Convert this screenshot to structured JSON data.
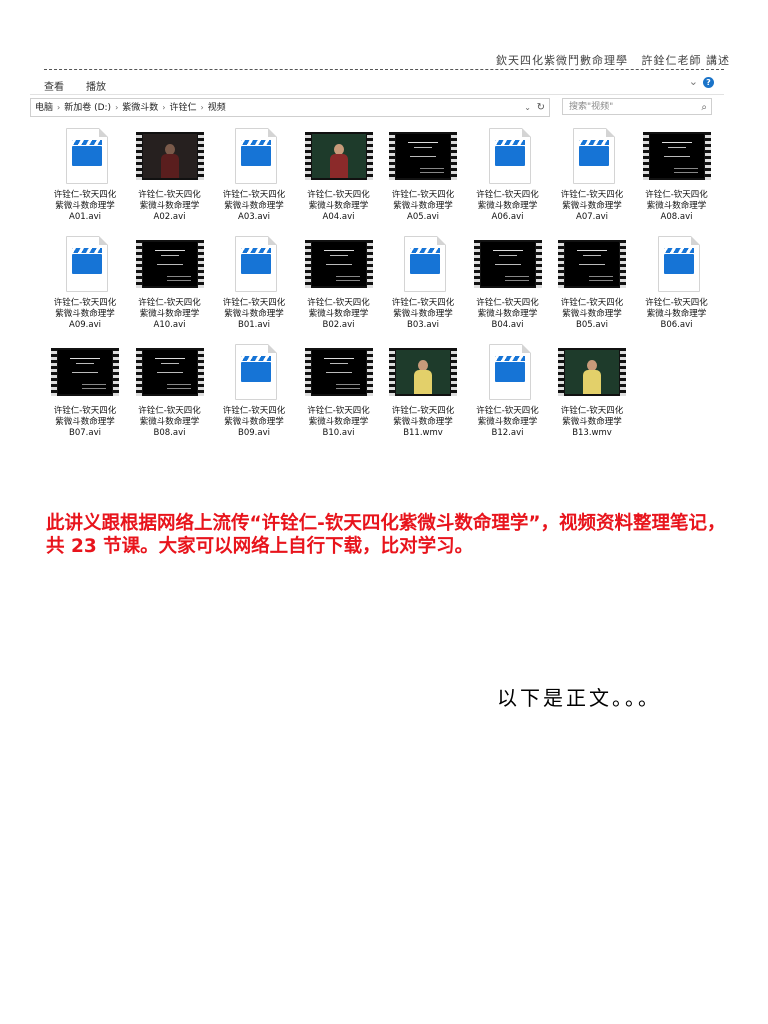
{
  "header": {
    "title": "欽天四化紫微鬥數命理學",
    "author": "許銓仁老師 講述"
  },
  "explorer": {
    "ribbon": {
      "tab_view": "查看",
      "tab_play": "播放"
    },
    "breadcrumb": [
      "电脑",
      "新加卷 (D:)",
      "紫微斗数",
      "许铨仁",
      "视频"
    ],
    "search_placeholder": "搜索\"视频\"",
    "icons": {
      "play": "video-file-icon",
      "thumbnail": "video-thumbnail"
    },
    "files": [
      {
        "line1": "许铨仁-钦天四化",
        "line2": "紫微斗数命理学",
        "line3": "A01.avi",
        "thumb": "icon"
      },
      {
        "line1": "许铨仁-钦天四化",
        "line2": "紫微斗数命理学",
        "line3": "A02.avi",
        "thumb": "dark-man"
      },
      {
        "line1": "许铨仁-钦天四化",
        "line2": "紫微斗数命理学",
        "line3": "A03.avi",
        "thumb": "icon"
      },
      {
        "line1": "许铨仁-钦天四化",
        "line2": "紫微斗数命理学",
        "line3": "A04.avi",
        "thumb": "blackboard"
      },
      {
        "line1": "许铨仁-钦天四化",
        "line2": "紫微斗数命理学",
        "line3": "A05.avi",
        "thumb": "slide"
      },
      {
        "line1": "许铨仁-钦天四化",
        "line2": "紫微斗数命理学",
        "line3": "A06.avi",
        "thumb": "icon"
      },
      {
        "line1": "许铨仁-钦天四化",
        "line2": "紫微斗数命理学",
        "line3": "A07.avi",
        "thumb": "icon"
      },
      {
        "line1": "许铨仁-钦天四化",
        "line2": "紫微斗数命理学",
        "line3": "A08.avi",
        "thumb": "slide"
      },
      {
        "line1": "许铨仁-钦天四化",
        "line2": "紫微斗数命理学",
        "line3": "A09.avi",
        "thumb": "icon"
      },
      {
        "line1": "许铨仁-钦天四化",
        "line2": "紫微斗数命理学",
        "line3": "A10.avi",
        "thumb": "slide"
      },
      {
        "line1": "许铨仁-钦天四化",
        "line2": "紫微斗数命理学",
        "line3": "B01.avi",
        "thumb": "icon"
      },
      {
        "line1": "许铨仁-钦天四化",
        "line2": "紫微斗数命理学",
        "line3": "B02.avi",
        "thumb": "slide"
      },
      {
        "line1": "许铨仁-钦天四化",
        "line2": "紫微斗数命理学",
        "line3": "B03.avi",
        "thumb": "icon"
      },
      {
        "line1": "许铨仁-钦天四化",
        "line2": "紫微斗数命理学",
        "line3": "B04.avi",
        "thumb": "slide"
      },
      {
        "line1": "许铨仁-钦天四化",
        "line2": "紫微斗数命理学",
        "line3": "B05.avi",
        "thumb": "slide"
      },
      {
        "line1": "许铨仁-钦天四化",
        "line2": "紫微斗数命理学",
        "line3": "B06.avi",
        "thumb": "icon"
      },
      {
        "line1": "许铨仁-钦天四化",
        "line2": "紫微斗数命理学",
        "line3": "B07.avi",
        "thumb": "slide"
      },
      {
        "line1": "许铨仁-钦天四化",
        "line2": "紫微斗数命理学",
        "line3": "B08.avi",
        "thumb": "slide"
      },
      {
        "line1": "许铨仁-钦天四化",
        "line2": "紫微斗数命理学",
        "line3": "B09.avi",
        "thumb": "icon"
      },
      {
        "line1": "许铨仁-钦天四化",
        "line2": "紫微斗数命理学",
        "line3": "B10.avi",
        "thumb": "slide"
      },
      {
        "line1": "许铨仁-钦天四化",
        "line2": "紫微斗数命理学",
        "line3": "B11.wmv",
        "thumb": "blackboard-light"
      },
      {
        "line1": "许铨仁-钦天四化",
        "line2": "紫微斗数命理学",
        "line3": "B12.avi",
        "thumb": "icon"
      },
      {
        "line1": "许铨仁-钦天四化",
        "line2": "紫微斗数命理学",
        "line3": "B13.wmv",
        "thumb": "blackboard-light"
      }
    ]
  },
  "notice": "此讲义跟根据网络上流传“许铨仁-钦天四化紫微斗数命理学”，视频资料整理笔记，共 23 节课。大家可以网络上自行下载，比对学习。",
  "closing": "以下是正文。。。",
  "colors": {
    "notice_red": "#e8141c",
    "icon_blue": "#1674d6"
  }
}
